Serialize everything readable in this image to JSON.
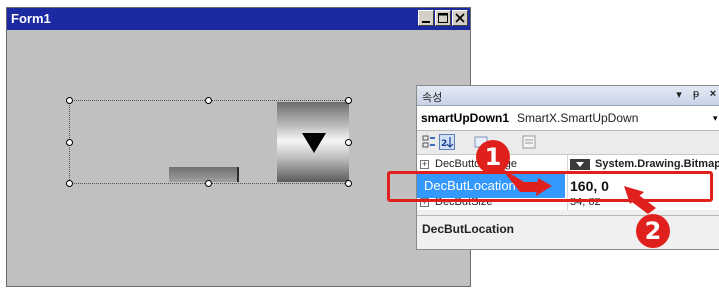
{
  "form": {
    "title": "Form1",
    "buttons": [
      "minimize-icon",
      "maximize-icon",
      "close-icon"
    ],
    "titlebar_color": "#1b2aa1",
    "client_color": "#c0c0c0"
  },
  "properties_panel": {
    "title": "속성",
    "header_buttons": {
      "pin": "▾",
      "dock": "ᵽ",
      "close": "×"
    },
    "object_name": "smartUpDown1",
    "object_type": "SmartX.SmartUpDown",
    "rows": {
      "image": {
        "name": "DecButtonImage",
        "value": "System.Drawing.Bitmap"
      },
      "location": {
        "name": "DecButLocation",
        "value": "160, 0"
      },
      "size": {
        "name": "DecButSize",
        "value": "34, 62"
      }
    },
    "description_title": "DecButLocation",
    "selected_row_color": "#3399ff"
  },
  "annotations": {
    "marker_1": "1",
    "marker_2": "2",
    "accent_color": "#e0201c"
  }
}
